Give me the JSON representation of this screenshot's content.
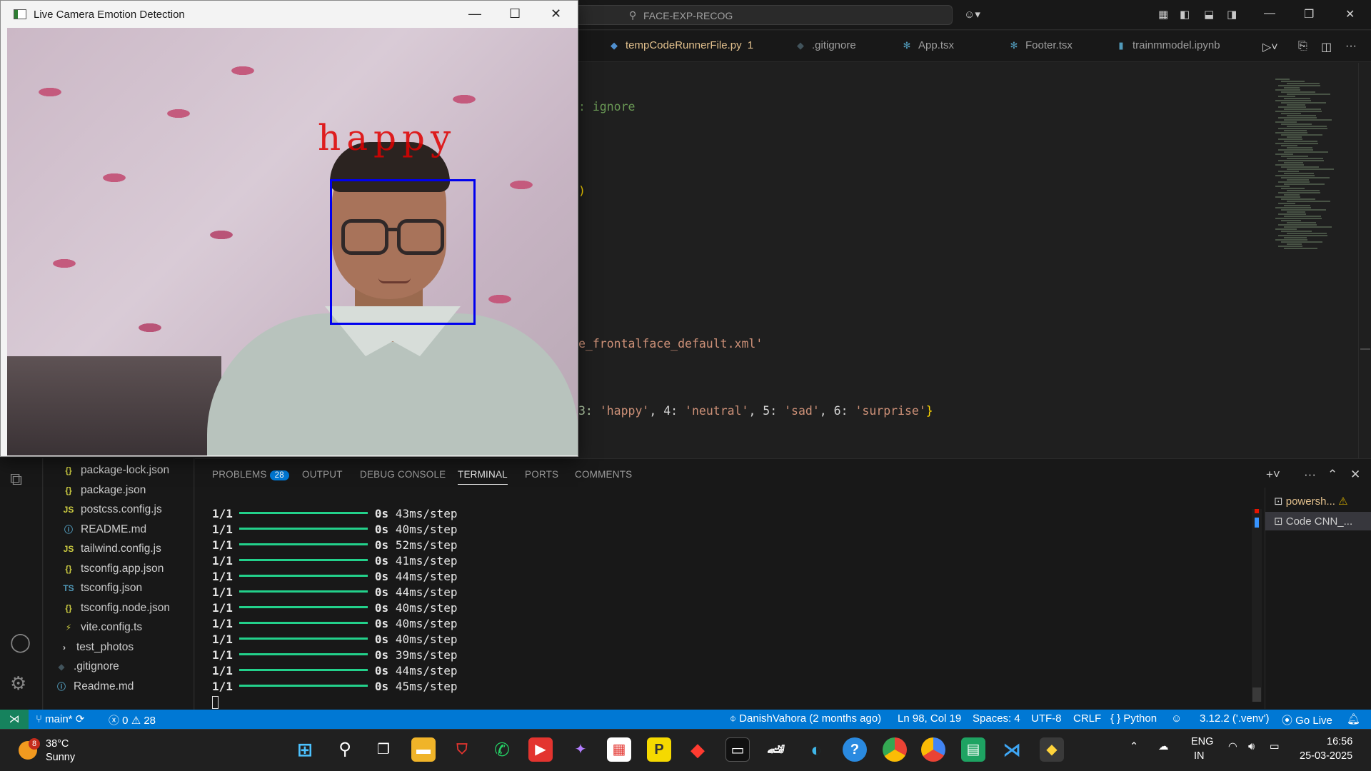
{
  "titlebar": {
    "search_text": "FACE-EXP-RECOG"
  },
  "tabs": [
    {
      "label": "tempCodeRunnerFile.py",
      "badge": "1",
      "icon": "python-icon",
      "active": true
    },
    {
      "label": ".gitignore",
      "icon": "git-icon"
    },
    {
      "label": "App.tsx",
      "icon": "react-icon"
    },
    {
      "label": "Footer.tsx",
      "icon": "react-icon"
    },
    {
      "label": "trainmmodel.ipynb",
      "icon": "notebook-icon"
    }
  ],
  "editor": {
    "line1": ": ignore",
    "line2": ")",
    "line3": "e_frontalface_default.xml'",
    "line4_parts": [
      "3: ",
      "'happy'",
      ", 4: ",
      "'neutral'",
      ", 5: ",
      "'sad'",
      ", 6: ",
      "'surprise'",
      "}"
    ]
  },
  "explorer": {
    "items": [
      {
        "label": "package-lock.json",
        "icon": "{}",
        "color": "#cbcb41"
      },
      {
        "label": "package.json",
        "icon": "{}",
        "color": "#cbcb41"
      },
      {
        "label": "postcss.config.js",
        "icon": "JS",
        "color": "#cbcb41"
      },
      {
        "label": "README.md",
        "icon": "ⓘ",
        "color": "#519aba"
      },
      {
        "label": "tailwind.config.js",
        "icon": "JS",
        "color": "#cbcb41"
      },
      {
        "label": "tsconfig.app.json",
        "icon": "{}",
        "color": "#cbcb41"
      },
      {
        "label": "tsconfig.json",
        "icon": "TS",
        "color": "#519aba"
      },
      {
        "label": "tsconfig.node.json",
        "icon": "{}",
        "color": "#cbcb41"
      },
      {
        "label": "vite.config.ts",
        "icon": "⚡",
        "color": "#cbcb41"
      },
      {
        "label": "test_photos",
        "icon": "›",
        "color": "#cccccc"
      },
      {
        "label": ".gitignore",
        "icon": "◆",
        "color": "#41535b"
      },
      {
        "label": "Readme.md",
        "icon": "ⓘ",
        "color": "#519aba"
      }
    ]
  },
  "panel": {
    "tabs": {
      "problems": "PROBLEMS",
      "problems_count": "28",
      "output": "OUTPUT",
      "debug": "DEBUG CONSOLE",
      "terminal": "TERMINAL",
      "ports": "PORTS",
      "comments": "COMMENTS"
    },
    "terminal_rows": [
      {
        "step": "1/1",
        "time": "0s",
        "rate": "43ms/step"
      },
      {
        "step": "1/1",
        "time": "0s",
        "rate": "40ms/step"
      },
      {
        "step": "1/1",
        "time": "0s",
        "rate": "52ms/step"
      },
      {
        "step": "1/1",
        "time": "0s",
        "rate": "41ms/step"
      },
      {
        "step": "1/1",
        "time": "0s",
        "rate": "44ms/step"
      },
      {
        "step": "1/1",
        "time": "0s",
        "rate": "44ms/step"
      },
      {
        "step": "1/1",
        "time": "0s",
        "rate": "40ms/step"
      },
      {
        "step": "1/1",
        "time": "0s",
        "rate": "40ms/step"
      },
      {
        "step": "1/1",
        "time": "0s",
        "rate": "40ms/step"
      },
      {
        "step": "1/1",
        "time": "0s",
        "rate": "39ms/step"
      },
      {
        "step": "1/1",
        "time": "0s",
        "rate": "44ms/step"
      },
      {
        "step": "1/1",
        "time": "0s",
        "rate": "45ms/step"
      }
    ],
    "terminals": [
      {
        "label": "powersh...",
        "warn": "⚠"
      },
      {
        "label": "Code  CNN_..."
      }
    ]
  },
  "statusbar": {
    "branch": "main*",
    "errors": "0",
    "warnings": "28",
    "blame": "DanishVahora (2 months ago)",
    "position": "Ln 98, Col 19",
    "spaces": "Spaces: 4",
    "encoding": "UTF-8",
    "eol": "CRLF",
    "language": "Python",
    "interpreter": "3.12.2 ('.venv')",
    "golive": "Go Live"
  },
  "camera": {
    "title": "Live Camera Emotion Detection",
    "emotion": "happy"
  },
  "taskbar": {
    "weather_badge": "8",
    "temp": "38°C",
    "condition": "Sunny",
    "lang": "ENG",
    "region": "IN",
    "time": "16:56",
    "date": "25-03-2025"
  }
}
